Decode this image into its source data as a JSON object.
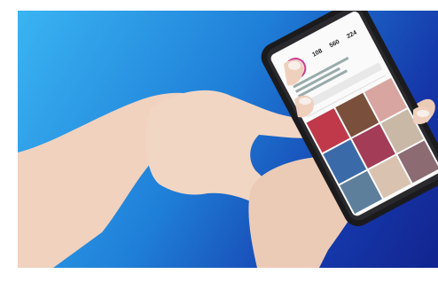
{
  "photo": {
    "background_gradient": [
      "#3ab4f2",
      "#1f7fd8",
      "#1536a8",
      "#12248f"
    ],
    "skin_color": "#f1d6c4",
    "nail_color": "#f7efe9",
    "phone_color": "#1b1b1e"
  },
  "screen": {
    "profile_stats": [
      "108",
      "560",
      "224"
    ]
  }
}
